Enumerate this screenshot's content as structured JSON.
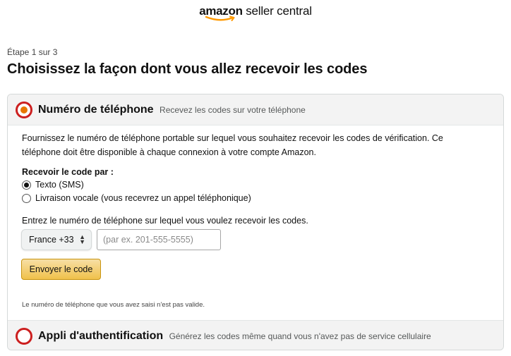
{
  "header": {
    "logo_amazon": "amazon",
    "logo_rest": " seller central"
  },
  "page": {
    "step": "Étape 1 sur 3",
    "title": "Choisissez la façon dont vous allez recevoir les codes"
  },
  "phone_option": {
    "title": "Numéro de téléphone",
    "subtitle": "Recevez les codes sur votre téléphone",
    "selected": true,
    "description_line1": "Fournissez le numéro de téléphone portable sur lequel vous souhaitez recevoir les codes de vérification. Ce",
    "description_line2": "téléphone doit être disponible à chaque connexion à votre compte Amazon.",
    "receive_label": "Recevoir le code par :",
    "delivery_methods": [
      {
        "label": "Texto (SMS)",
        "checked": true
      },
      {
        "label": "Livraison vocale (vous recevrez un appel téléphonique)",
        "checked": false
      }
    ],
    "enter_label": "Entrez le numéro de téléphone sur lequel vous voulez recevoir les codes.",
    "country_select": "France +33",
    "phone_placeholder": "(par ex. 201-555-5555)",
    "phone_value": "",
    "send_button": "Envoyer le code",
    "error_message": "Le numéro de téléphone que vous avez saisi n'est pas valide."
  },
  "auth_app_option": {
    "title": "Appli d'authentification",
    "subtitle": "Générez les codes même quand vous n'avez pas de service cellulaire",
    "selected": false
  },
  "colors": {
    "highlight_ring": "#cc1f1f",
    "radio_selected": "#e77600",
    "button_yellow": "#f0c14b",
    "logo_smile": "#ff9900"
  },
  "icons": {
    "country_select_arrows": "up-down-chevron-icon",
    "logo_smile": "amazon-smile-icon"
  }
}
